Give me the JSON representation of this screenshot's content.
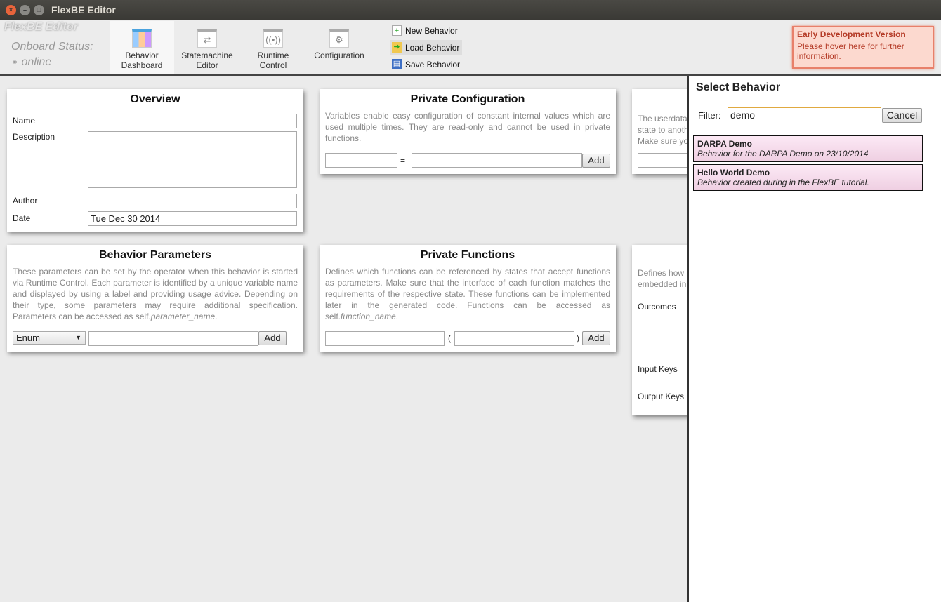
{
  "window": {
    "title": "FlexBE Editor"
  },
  "toolbar": {
    "brand": "FlexBE Editor",
    "onboard_label": "Onboard Status:",
    "onboard_value": "online",
    "nav": [
      {
        "label": "Behavior",
        "label2": "Dashboard",
        "icon": "dashboard-icon",
        "active": true
      },
      {
        "label": "Statemachine",
        "label2": "Editor",
        "icon": "statemachine-icon"
      },
      {
        "label": "Runtime",
        "label2": "Control",
        "icon": "runtime-icon"
      },
      {
        "label": "Configuration",
        "label2": "",
        "icon": "gear-icon"
      }
    ],
    "actions": [
      {
        "label": "New Behavior",
        "icon": "new-file-icon"
      },
      {
        "label": "Load Behavior",
        "icon": "load-folder-icon"
      },
      {
        "label": "Save Behavior",
        "icon": "save-disk-icon"
      }
    ],
    "warning": {
      "title": "Early Development Version",
      "text": "Please hover here for further information."
    }
  },
  "overview": {
    "title": "Overview",
    "name_label": "Name",
    "description_label": "Description",
    "author_label": "Author",
    "date_label": "Date",
    "date_value": "Tue Dec 30 2014"
  },
  "private_config": {
    "title": "Private Configuration",
    "description": "Variables enable easy configuration of constant internal values which are used multiple times. They are read-only and cannot be used in private functions.",
    "equals": "=",
    "add": "Add"
  },
  "userdata": {
    "description_partial": "The userdata... state to anoth... Make sure yo..."
  },
  "userdata_lines": [
    "The userdata",
    "state to anoth",
    "Make sure yo"
  ],
  "params": {
    "title": "Behavior Parameters",
    "description": "These parameters can be set by the operator when this behavior is started via Runtime Control. Each parameter is identified by a unique variable name and displayed by using a label and providing usage advice. Depending on their type, some parameters may require additional specification. Parameters can be accessed as self.",
    "description_em": "parameter_name",
    "type_selected": "Enum",
    "add": "Add"
  },
  "functions": {
    "title": "Private Functions",
    "description": "Defines which functions can be referenced by states that accept functions as parameters. Make sure that the interface of each function matches the requirements of the respective state. These functions can be implemented later in the generated code. Functions can be accessed as self.",
    "description_em": "function_name",
    "open_paren": "(",
    "close_paren": ")",
    "add": "Add"
  },
  "interface": {
    "desc_lines": [
      "Defines how",
      "embedded in"
    ],
    "outcomes": "Outcomes",
    "input_keys": "Input Keys",
    "output_keys": "Output Keys"
  },
  "select": {
    "title": "Select Behavior",
    "filter_label": "Filter:",
    "filter_value": "demo",
    "cancel": "Cancel",
    "items": [
      {
        "name": "DARPA Demo",
        "description": "Behavior for the DARPA Demo on 23/10/2014"
      },
      {
        "name": "Hello World Demo",
        "description": "Behavior created during in the FlexBE tutorial."
      }
    ]
  },
  "colors": {
    "titlebar": "#3c3b37",
    "warning_bg": "#fcd9cf",
    "warning_text": "#b43a26",
    "item_bg": "#f5dcec"
  }
}
